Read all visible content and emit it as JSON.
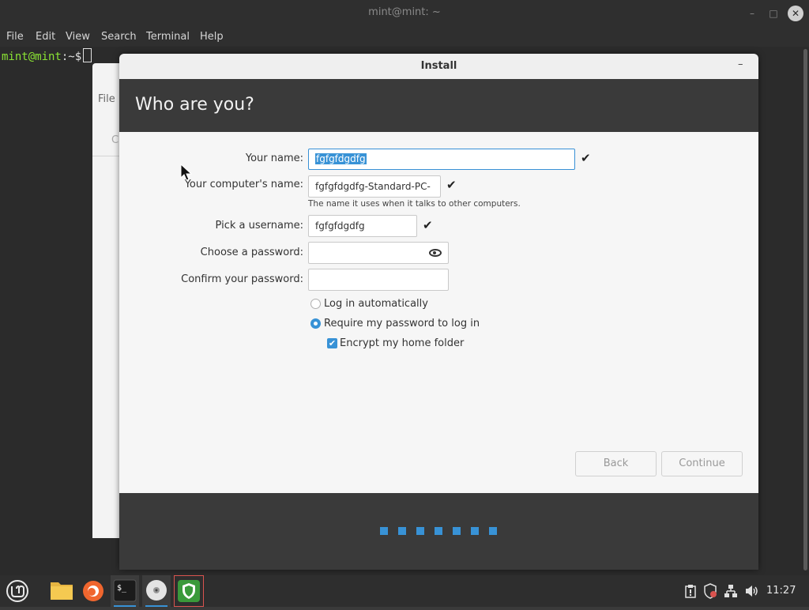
{
  "terminal": {
    "title": "mint@mint: ~",
    "menu": [
      "File",
      "Edit",
      "View",
      "Search",
      "Terminal",
      "Help"
    ],
    "prompt_user": "mint@mint",
    "prompt_rest": ":~$",
    "close_glyph": "✕",
    "min_glyph": "–",
    "max_glyph": "□"
  },
  "back_window": {
    "menu_label": "File",
    "partial_label": "C"
  },
  "installer": {
    "title": "Install",
    "minimize_glyph": "–",
    "page_title": "Who are you?",
    "fields": {
      "your_name": {
        "label": "Your name:",
        "value": "fgfgfdgdfg"
      },
      "computer_name": {
        "label": "Your computer's name:",
        "value": "fgfgfdgdfg-Standard-PC-",
        "hint": "The name it uses when it talks to other computers."
      },
      "username": {
        "label": "Pick a username:",
        "value": "fgfgfdgdfg"
      },
      "password": {
        "label": "Choose a password:",
        "value": ""
      },
      "confirm_password": {
        "label": "Confirm your password:",
        "value": ""
      }
    },
    "options": {
      "login_auto": {
        "label": "Log in automatically",
        "selected": false
      },
      "require_password": {
        "label": "Require my password to log in",
        "selected": true
      },
      "encrypt_home": {
        "label": "Encrypt my home folder",
        "checked": true
      }
    },
    "check_glyph": "✔",
    "buttons": {
      "back": "Back",
      "continue": "Continue"
    },
    "progress": {
      "total_steps": 7
    }
  },
  "taskbar": {
    "apps": [
      "menu-icon",
      "files-icon",
      "firefox-icon",
      "terminal-icon",
      "installer-disc-icon",
      "shield-update-icon"
    ],
    "tray": [
      "clipboard-icon",
      "shield-icon",
      "network-icon",
      "volume-icon"
    ],
    "clock": "11:27"
  },
  "colors": {
    "accent": "#3892d6",
    "dark_bg": "#2b2b2b",
    "installer_body": "#f6f6f6"
  }
}
